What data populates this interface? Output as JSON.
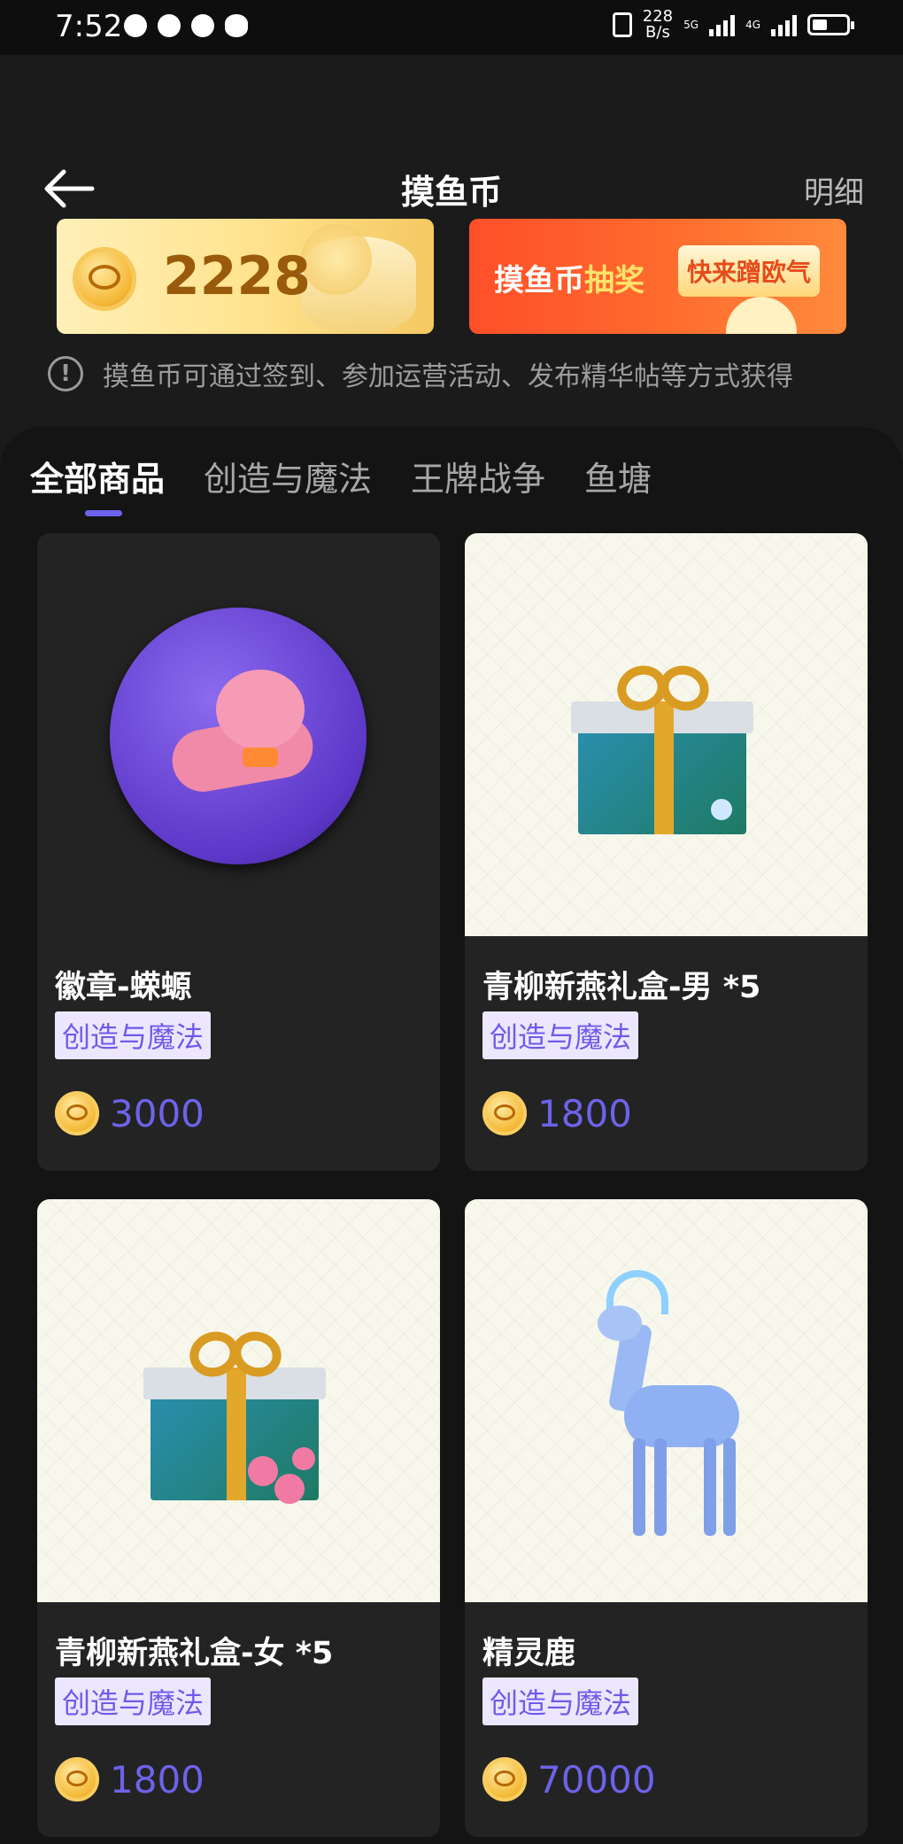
{
  "status_bar": {
    "time": "7:52",
    "net_speed_value": "228",
    "net_speed_unit": "B/s",
    "sim1_label": "5G",
    "sim2_label": "4G"
  },
  "header": {
    "title": "摸鱼币",
    "detail_label": "明细"
  },
  "balance": {
    "value": "2228"
  },
  "lottery_banner": {
    "text_prefix": "摸鱼币",
    "text_highlight": "抽奖",
    "badge": "快来蹭欧气"
  },
  "info": {
    "text": "摸鱼币可通过签到、参加运营活动、发布精华帖等方式获得"
  },
  "tabs": [
    {
      "label": "全部商品",
      "active": true
    },
    {
      "label": "创造与魔法",
      "active": false
    },
    {
      "label": "王牌战争",
      "active": false
    },
    {
      "label": "鱼塘",
      "active": false
    }
  ],
  "products": [
    {
      "name": "徽章-蝾螈",
      "tag": "创造与魔法",
      "price": "3000",
      "image": "badge-axolotl"
    },
    {
      "name": "青柳新燕礼盒-男 *5",
      "tag": "创造与魔法",
      "price": "1800",
      "image": "gift-box-blue"
    },
    {
      "name": "青柳新燕礼盒-女 *5",
      "tag": "创造与魔法",
      "price": "1800",
      "image": "gift-box-flowers"
    },
    {
      "name": "精灵鹿",
      "tag": "创造与魔法",
      "price": "70000",
      "image": "spirit-deer"
    }
  ],
  "colors": {
    "accent": "#6d63ea",
    "tag_bg": "#ece7ff",
    "background": "#141414",
    "card_bg": "#232323"
  }
}
